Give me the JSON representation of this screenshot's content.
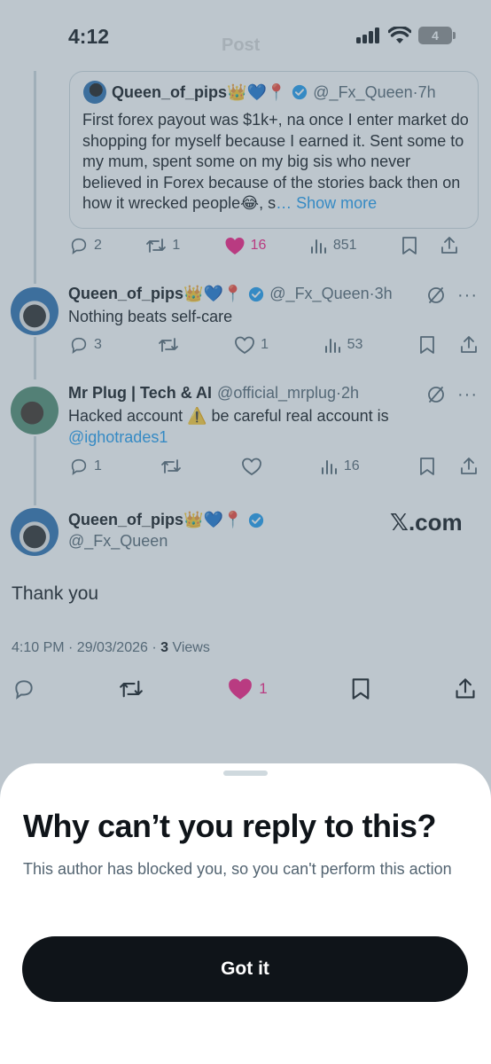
{
  "status_bar": {
    "time": "4:12",
    "battery": "4"
  },
  "header": {
    "title": "Post"
  },
  "quoted_post": {
    "name": "Queen_of_pips",
    "emojis": "👑💙📍",
    "handle": "@_Fx_Queen",
    "time": "7h",
    "text": "First forex payout was $1k+, na once I enter market do shopping for myself because I earned it. Sent some to my mum, spent some on my big sis who never believed in Forex because of the stories back then on how it wrecked people😂, s",
    "show_more": "… Show more",
    "replies": "2",
    "reposts": "1",
    "likes": "16",
    "views": "851"
  },
  "reply1": {
    "name": "Queen_of_pips",
    "emojis": "👑💙📍",
    "handle": "@_Fx_Queen",
    "time": "3h",
    "text": "Nothing beats self-care",
    "replies": "3",
    "likes": "1",
    "views": "53"
  },
  "reply2": {
    "name": "Mr Plug | Tech & AI",
    "handle": "@official_mrplug",
    "time": "2h",
    "text": "Hacked account ⚠️ be careful real account is",
    "mention": "@ighotrades1",
    "replies": "1",
    "views": "16"
  },
  "main_post": {
    "name": "Queen_of_pips",
    "emojis": "👑💙📍",
    "handle": "@_Fx_Queen",
    "watermark": "𝕏.com",
    "text": "Thank you",
    "timestamp": "4:10 PM · 29/03/2026 · ",
    "views_count": "3",
    "views_label": " Views",
    "likes": "1"
  },
  "sheet": {
    "title": "Why can’t you reply to this?",
    "message": "This author has blocked you, so you can't perform this action",
    "button": "Got it"
  },
  "colors": {
    "like": "#f91880",
    "verified": "#1d9bf0",
    "link": "#1d9bf0",
    "button": "#0f1419"
  }
}
